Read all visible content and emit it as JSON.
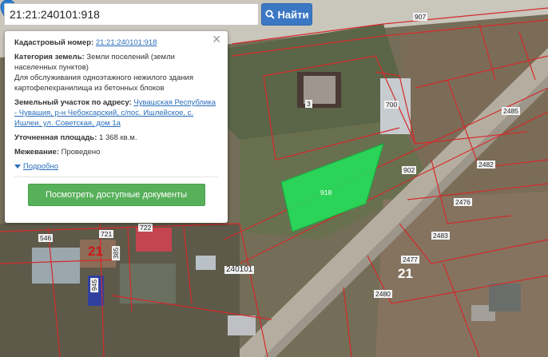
{
  "search": {
    "value": "21:21:240101:918",
    "button_label": "Найти"
  },
  "popup": {
    "cadastral_label": "Кадастровый номер:",
    "cadastral_value": "21:21:240101:918",
    "category_label": "Категория земель:",
    "category_value": "Земли поселений (земли населенных пунктов)",
    "purpose_value": "Для обслуживания одноэтажного нежилого здания картофелехранилища из бетонных блоков",
    "address_label": "Земельный участок по адресу:",
    "address_value": "Чувашская Республика - Чувашия, р-н Чебоксарский, с/пос. Ишлейское, с. Ишлеи, ул. Советская, дом 1а",
    "area_label": "Уточненная площадь:",
    "area_value": "1 368 кв.м.",
    "survey_label": "Межевание:",
    "survey_value": "Проведено",
    "more_label": "Подробно",
    "docs_button_label": "Посмотреть доступные документы"
  },
  "map_labels": {
    "p907": "907",
    "p3": "3",
    "p700": "700",
    "p2485": "2485",
    "p902": "902",
    "p2482": "2482",
    "p918": "918",
    "p2476": "2476",
    "p2483": "2483",
    "p546": "546",
    "p721": "721",
    "p722": "722",
    "q21a": "21",
    "q240101": "240101",
    "p2477": "2477",
    "q21b": "21",
    "p2480": "2480",
    "p945": "945",
    "p385": "385"
  },
  "colors": {
    "parcel_highlight": "#22e05a",
    "boundary": "#d42a2a",
    "accent": "#3a78c4",
    "docs_button": "#57b05a"
  }
}
